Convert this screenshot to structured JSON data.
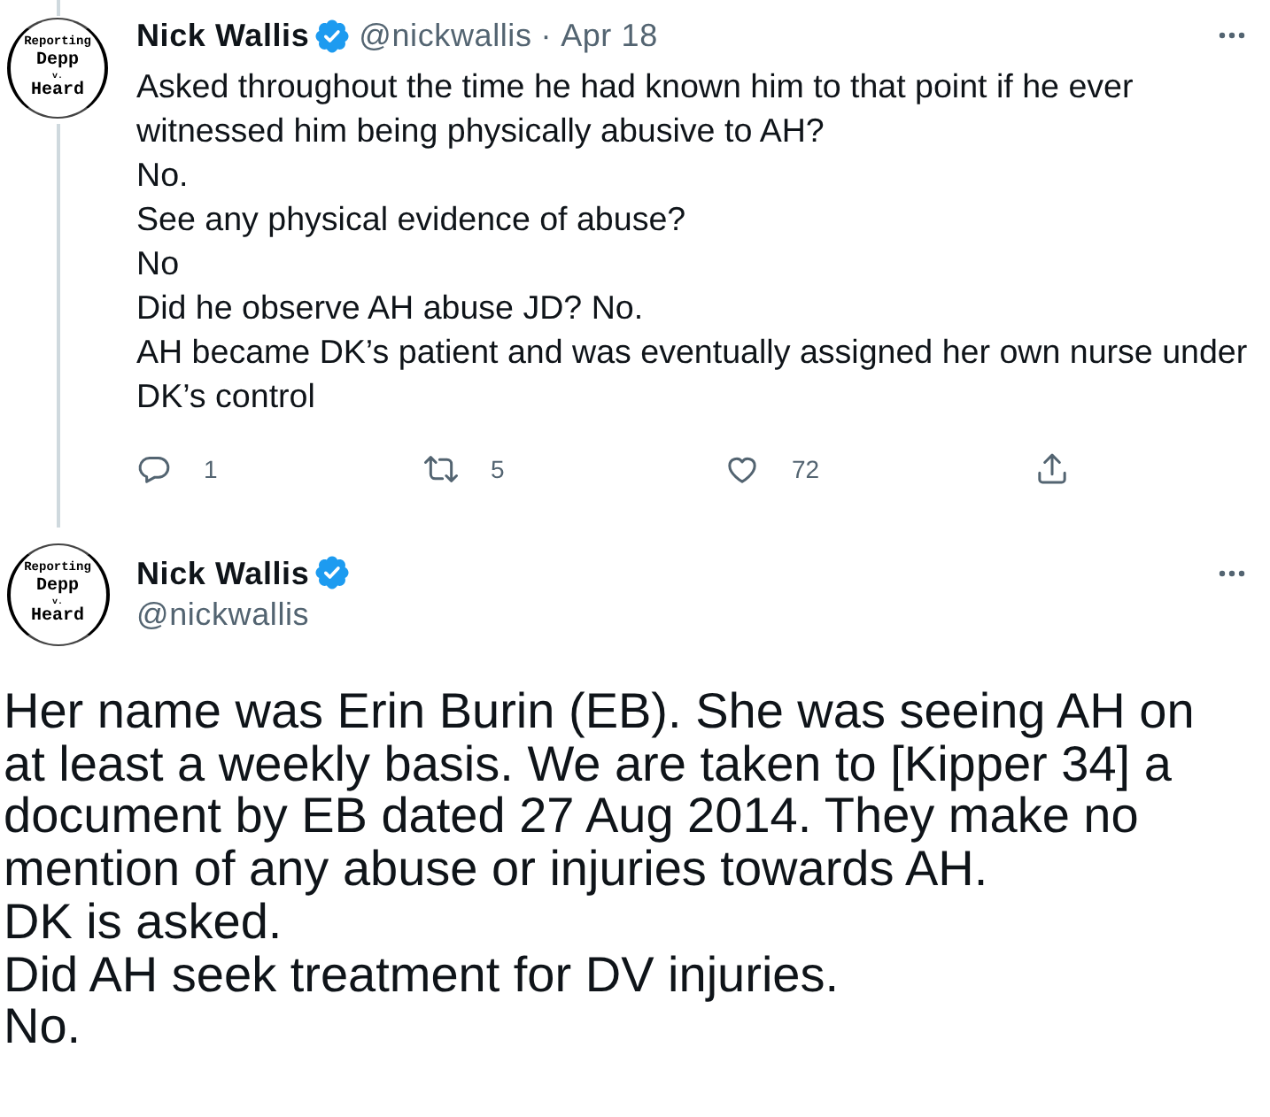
{
  "tweets": [
    {
      "kind": "thread",
      "avatar": {
        "lines": [
          "Reporting",
          "Depp",
          "v.",
          "Heard"
        ]
      },
      "name": "Nick Wallis",
      "verified": true,
      "handle": "@nickwallis",
      "separator": "·",
      "date": "Apr 18",
      "paragraphs": [
        "Asked throughout the time he had known him to that point if he ever witnessed him being physically abusive to AH?",
        "No.",
        "See any physical evidence of abuse?",
        "No",
        "Did he observe AH abuse JD? No.",
        "AH became DK’s patient and was eventually assigned her own nurse under DK’s control"
      ],
      "actions": [
        {
          "kind": "reply",
          "count": "1"
        },
        {
          "kind": "retweet",
          "count": "5"
        },
        {
          "kind": "like",
          "count": "72"
        },
        {
          "kind": "share"
        }
      ]
    },
    {
      "kind": "main",
      "avatar": {
        "lines": [
          "Reporting",
          "Depp",
          "v.",
          "Heard"
        ]
      },
      "name": "Nick Wallis",
      "verified": true,
      "handle": "@nickwallis",
      "paragraphs": [
        "Her name was Erin Burin (EB). She was seeing AH on at least a weekly basis. We are taken to [Kipper 34] a document by EB dated 27 Aug 2014. They make no mention of any abuse or injuries towards AH.",
        "DK is asked.",
        "Did AH seek treatment for DV injuries.",
        "No."
      ]
    }
  ]
}
